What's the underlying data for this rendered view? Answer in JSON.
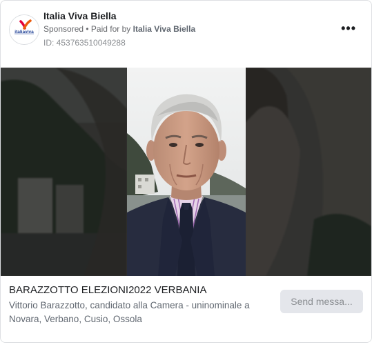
{
  "advertiser": {
    "name": "Italia Viva Biella",
    "logo_text": "italiaviva",
    "sponsored_label": "Sponsored",
    "paid_for_prefix": " • Paid for by ",
    "paid_for_name": "Italia Viva Biella",
    "library_id": "ID: 453763510049288"
  },
  "menu": {
    "icon": "more-horizontal-icon",
    "glyph": "•••"
  },
  "media": {
    "type": "video",
    "subject": "man-in-suit-portrait"
  },
  "ad": {
    "title": "BARAZZOTTO ELEZIONI2022 VERBANIA",
    "description": "Vittorio Barazzotto, candidato alla Camera - uninominale a Novara, Verbano, Cusio, Ossola",
    "cta_label": "Send messa..."
  },
  "colors": {
    "logo_red": "#e4003a",
    "logo_blue": "#1d3f95",
    "cta_bg": "#e4e6eb"
  }
}
